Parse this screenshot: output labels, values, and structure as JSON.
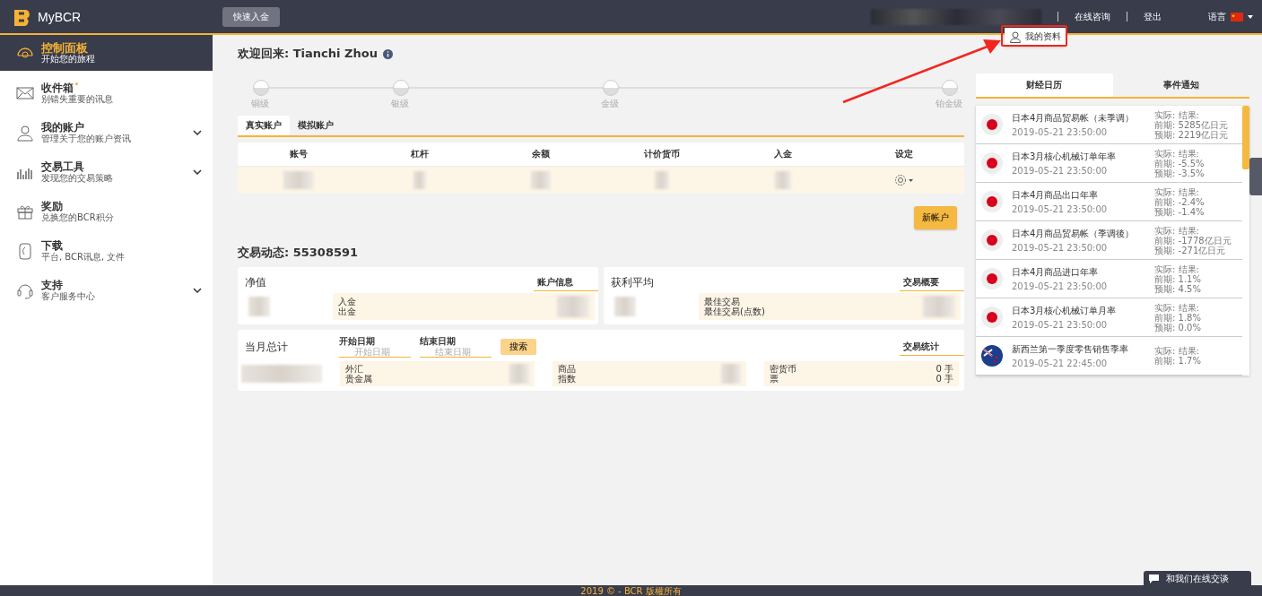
{
  "header": {
    "brand": "MyBCR",
    "deposit_button": "快速入金",
    "links": [
      "在线咨询",
      "登出"
    ],
    "language": "语言",
    "dropdown_item": "我的资料"
  },
  "sidebar": {
    "items": [
      {
        "title": "控制面板",
        "subtitle": "开始您的旅程",
        "selected": true,
        "expandable": false,
        "unread": false
      },
      {
        "title": "收件箱",
        "subtitle": "别错失重要的讯息",
        "selected": false,
        "expandable": false,
        "unread": true
      },
      {
        "title": "我的账户",
        "subtitle": "管理关于您的账户资讯",
        "selected": false,
        "expandable": true,
        "unread": false
      },
      {
        "title": "交易工具",
        "subtitle": "发现您的交易策略",
        "selected": false,
        "expandable": true,
        "unread": false
      },
      {
        "title": "奖励",
        "subtitle": "兑换您的BCR积分",
        "selected": false,
        "expandable": false,
        "unread": false
      },
      {
        "title": "下载",
        "subtitle": "平台, BCR讯息, 文件",
        "selected": false,
        "expandable": false,
        "unread": false
      },
      {
        "title": "支持",
        "subtitle": "客户服务中心",
        "selected": false,
        "expandable": true,
        "unread": false
      }
    ]
  },
  "welcome": {
    "prefix": "欢迎回来:",
    "name": "Tianchi Zhou"
  },
  "levels": [
    "铜级",
    "银级",
    "金级",
    "铂金级"
  ],
  "account_tabs": [
    {
      "label": "真实账户",
      "selected": true
    },
    {
      "label": "模拟账户",
      "selected": false
    }
  ],
  "accounts_table": {
    "columns": [
      "账号",
      "杠杆",
      "余额",
      "计价货币",
      "入金",
      "设定"
    ]
  },
  "new_account_button": "新帐户",
  "activity": {
    "title": "交易动态:",
    "account": "55308591",
    "cards": [
      {
        "title": "净值",
        "tab": "账户信息",
        "labels": [
          "入金",
          "出金"
        ]
      },
      {
        "title": "获利平均",
        "tab": "交易概要",
        "labels": [
          "最佳交易",
          "最佳交易(点数)"
        ]
      }
    ],
    "monthly": {
      "title": "当月总计",
      "start": {
        "label": "开始日期",
        "placeholder": "开始日期"
      },
      "end": {
        "label": "结束日期",
        "placeholder": "结束日期"
      },
      "search_button": "搜索",
      "tab": "交易统计",
      "groups": [
        {
          "labels": [
            "外汇",
            "贵金属"
          ]
        },
        {
          "labels": [
            "商品",
            "指数"
          ]
        },
        {
          "labels": [
            "密货币",
            "票"
          ],
          "values": [
            "0 手",
            "0 手"
          ]
        }
      ]
    }
  },
  "calendar": {
    "tabs": [
      {
        "label": "财经日历",
        "selected": true
      },
      {
        "label": "事件通知",
        "selected": false
      }
    ],
    "events": [
      {
        "kind": "japan",
        "title": "日本4月商品贸易帐（未季调）",
        "time": "2019-05-21 23:50:00",
        "stats": [
          "实际: 结果:",
          "前期: 5285亿日元",
          "预期: 2219亿日元"
        ]
      },
      {
        "kind": "japan",
        "title": "日本3月核心机械订单年率",
        "time": "2019-05-21 23:50:00",
        "stats": [
          "实际: 结果:",
          "前期: -5.5%",
          "预期: -3.5%"
        ]
      },
      {
        "kind": "japan",
        "title": "日本4月商品出口年率",
        "time": "2019-05-21 23:50:00",
        "stats": [
          "实际: 结果:",
          "前期: -2.4%",
          "预期: -1.4%"
        ]
      },
      {
        "kind": "japan",
        "title": "日本4月商品贸易帐（季调後）",
        "time": "2019-05-21 23:50:00",
        "stats": [
          "实际: 结果:",
          "前期: -1778亿日元",
          "预期: -271亿日元"
        ]
      },
      {
        "kind": "japan",
        "title": "日本4月商品进口年率",
        "time": "2019-05-21 23:50:00",
        "stats": [
          "实际: 结果:",
          "前期: 1.1%",
          "预期: 4.5%"
        ]
      },
      {
        "kind": "japan",
        "title": "日本3月核心机械订单月率",
        "time": "2019-05-21 23:50:00",
        "stats": [
          "实际: 结果:",
          "前期: 1.8%",
          "预期: 0.0%"
        ]
      },
      {
        "kind": "newzealand",
        "title": "新西兰第一季度零售销售季率",
        "time": "2019-05-21 22:45:00",
        "stats": [
          "实际: 结果:",
          "前期: 1.7%"
        ]
      }
    ]
  },
  "chat_button": "和我们在线交谈",
  "footer": "2019 © - BCR 版權所有"
}
